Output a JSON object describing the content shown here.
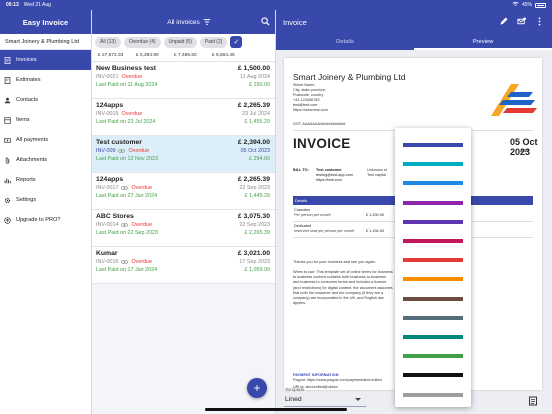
{
  "status_bar": {
    "time": "00:13",
    "date": "Wed 21 Aug",
    "battery": "45%"
  },
  "sidebar": {
    "app_title": "Easy Invoice",
    "company": "Smart Joinery & Plumbing Ltd",
    "items": [
      {
        "label": "Invoices",
        "icon": "invoice-icon",
        "active": true
      },
      {
        "label": "Estimates",
        "icon": "estimate-icon",
        "active": false
      },
      {
        "label": "Contacts",
        "icon": "person-icon",
        "active": false
      },
      {
        "label": "Items",
        "icon": "items-icon",
        "active": false
      },
      {
        "label": "All payments",
        "icon": "payments-icon",
        "active": false
      },
      {
        "label": "Attachments",
        "icon": "attachment-icon",
        "active": false
      },
      {
        "label": "Reports",
        "icon": "reports-icon",
        "active": false
      },
      {
        "label": "Settings",
        "icon": "gear-icon",
        "active": false
      },
      {
        "label": "Upgrade to PRO?",
        "icon": "upgrade-icon",
        "active": false
      }
    ]
  },
  "list": {
    "title": "All invoices",
    "chips": [
      "All (13)",
      "Overdue (4)",
      "Unpaid (5)",
      "Paid (2)"
    ],
    "totals": [
      "£ 27,672.33",
      "£ 5,394.90",
      "£ 7,486.60",
      "£ 5,664.45"
    ],
    "invoices": [
      {
        "client": "New Business test",
        "amount": "£ 1,500.00",
        "number": "INV-0021",
        "status": "Overdue",
        "date": "11 Aug 2024",
        "last_paid": "Last Paid on 11 Aug 2024",
        "paid_amount": "£ 150.00",
        "selected": false,
        "link": false
      },
      {
        "client": "124apps",
        "amount": "£ 2,265.39",
        "number": "INV-0019",
        "status": "Overdue",
        "date": "23 Jul 2024",
        "last_paid": "Last Paid on 23 Jul 2024",
        "paid_amount": "£ 1,455.29",
        "selected": false,
        "link": false
      },
      {
        "client": "Test customer",
        "amount": "£ 2,394.00",
        "number": "INV-009",
        "status": "Overdue",
        "date": "05 Oct 2023",
        "last_paid": "Last Paid on 12 Nov 2023",
        "paid_amount": "£ 294.00",
        "selected": true,
        "link": true
      },
      {
        "client": "124apps",
        "amount": "£ 2,265.39",
        "number": "INV-0017",
        "status": "Overdue",
        "date": "22 Sep 2023",
        "last_paid": "Last Paid on 27 Jan 2024",
        "paid_amount": "£ 1,445.29",
        "selected": false,
        "link": true
      },
      {
        "client": "ABC Stores",
        "amount": "£ 3,075.30",
        "number": "INV-0014",
        "status": "Overdue",
        "date": "22 Sep 2023",
        "last_paid": "Last Paid on 22 Sep 2023",
        "paid_amount": "£ 2,265.39",
        "selected": false,
        "link": true
      },
      {
        "client": "Kumar",
        "amount": "£ 3,021.00",
        "number": "INV-0016",
        "status": "Overdue",
        "date": "17 Sep 2023",
        "last_paid": "Last Paid on 17 Jan 2024",
        "paid_amount": "£ 1,059.00",
        "selected": false,
        "link": true
      }
    ],
    "fab": "+"
  },
  "detail": {
    "title": "Invoice",
    "tabs": [
      {
        "label": "Details",
        "active": false
      },
      {
        "label": "Preview",
        "active": true
      }
    ],
    "doc": {
      "company": "Smart Joinery & Plumbing Ltd",
      "address": [
        "Street Name,",
        "City, state province,",
        "Postcode, country",
        "+44 123456789",
        "test@test.com",
        "https://www.test.com"
      ],
      "gst": "GST: AAAAAAA4###########",
      "invoice_word": "INVOICE",
      "invoice_number_visible": "05 Oct 2023",
      "date_fragment": "2023",
      "bill_to_label": "BILL TO:",
      "bill_to_lines": [
        "Test customer",
        "testing@test-app.com",
        "https://test.com"
      ],
      "unknown_lines": [
        "Unknown st",
        "Test capital"
      ],
      "table_header": "Details",
      "items": [
        {
          "name": "Coworker",
          "detail": "Per person per month",
          "amount": "£ 1,200.00"
        },
        {
          "name": "Dedicated",
          "detail": "reserved seat per person per month",
          "amount": "£ 1,194.00"
        }
      ],
      "thanks": "Thanks you for your business and see you again.",
      "terms": "When to use: This template set of online terms for business to business content contains both business-to-business and business to consumer terms and includes a license (and restrictions) for digital content. the document assumes that both the customer and the company (if they are a company) are incorporated in the UK, and English law applies.",
      "payment_info": "PAYMENT INFORMATION",
      "paypal": "Paypal: https://www.paypal.com/payment/abcLimited",
      "upi": "UPI id: abcLimited@okicici"
    },
    "palette_colors": [
      "#3949ab",
      "#00acc1",
      "#1e88e5",
      "#8e24aa",
      "#5e35b1",
      "#c2185b",
      "#e53935",
      "#fb8c00",
      "#6d4c41",
      "#546e7a",
      "#00897b",
      "#43a047",
      "#111111",
      "#9e9e9e"
    ],
    "template_label": "Template",
    "template_value": "Lined"
  }
}
